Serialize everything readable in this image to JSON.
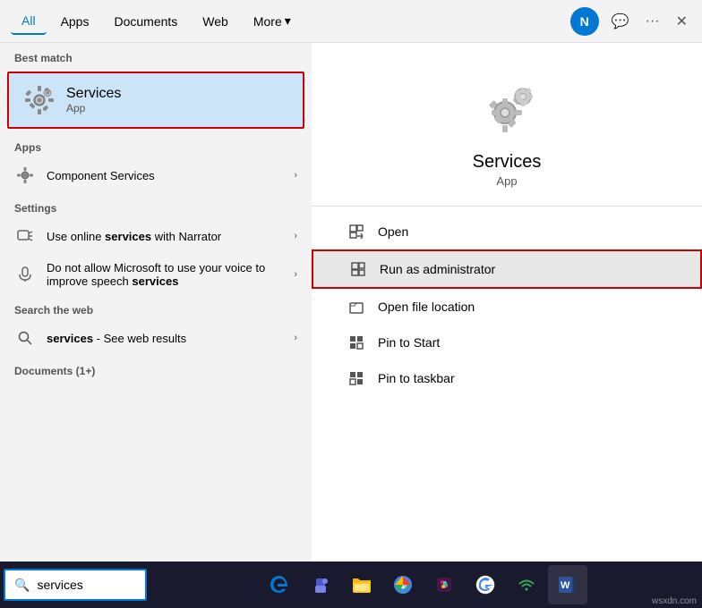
{
  "nav": {
    "tabs": [
      {
        "label": "All",
        "active": true
      },
      {
        "label": "Apps",
        "active": false
      },
      {
        "label": "Documents",
        "active": false
      },
      {
        "label": "Web",
        "active": false
      },
      {
        "label": "More",
        "active": false
      }
    ],
    "avatar": "N",
    "close_label": "✕"
  },
  "left_panel": {
    "best_match_label": "Best match",
    "best_match": {
      "title": "Services",
      "subtitle": "App"
    },
    "apps_label": "Apps",
    "apps_items": [
      {
        "label": "Component Services",
        "has_arrow": true
      }
    ],
    "settings_label": "Settings",
    "settings_items": [
      {
        "label_prefix": "Use online ",
        "bold": "services",
        "label_suffix": " with Narrator",
        "has_arrow": true
      },
      {
        "label_prefix": "Do not allow Microsoft to use your voice to improve speech ",
        "bold": "services",
        "label_suffix": "",
        "has_arrow": true
      }
    ],
    "search_web_label": "Search the web",
    "search_items": [
      {
        "label_prefix": "",
        "bold": "services",
        "label_suffix": " - See web results",
        "has_arrow": true
      }
    ],
    "documents_label": "Documents (1+)"
  },
  "right_panel": {
    "app_title": "Services",
    "app_subtitle": "App",
    "actions": [
      {
        "label": "Open",
        "highlighted": false
      },
      {
        "label": "Run as administrator",
        "highlighted": true
      },
      {
        "label": "Open file location",
        "highlighted": false
      },
      {
        "label": "Pin to Start",
        "highlighted": false
      },
      {
        "label": "Pin to taskbar",
        "highlighted": false
      }
    ]
  },
  "taskbar": {
    "search_value": "services",
    "search_placeholder": "services",
    "watermark": "wsxdn.com"
  },
  "icons": {
    "search": "🔍",
    "gear": "⚙",
    "arrow_right": "›",
    "open": "↗",
    "run_as": "🛡",
    "file_loc": "📄",
    "pin_start": "📌",
    "pin_taskbar": "📌",
    "more_arrow": "▾",
    "feedback": "💬",
    "ellipsis": "···",
    "edge": "🌐",
    "teams": "👥",
    "files": "📁",
    "chrome_like": "⬤",
    "slack_like": "⬟",
    "google": "G",
    "wifi": "📶",
    "word": "W"
  }
}
